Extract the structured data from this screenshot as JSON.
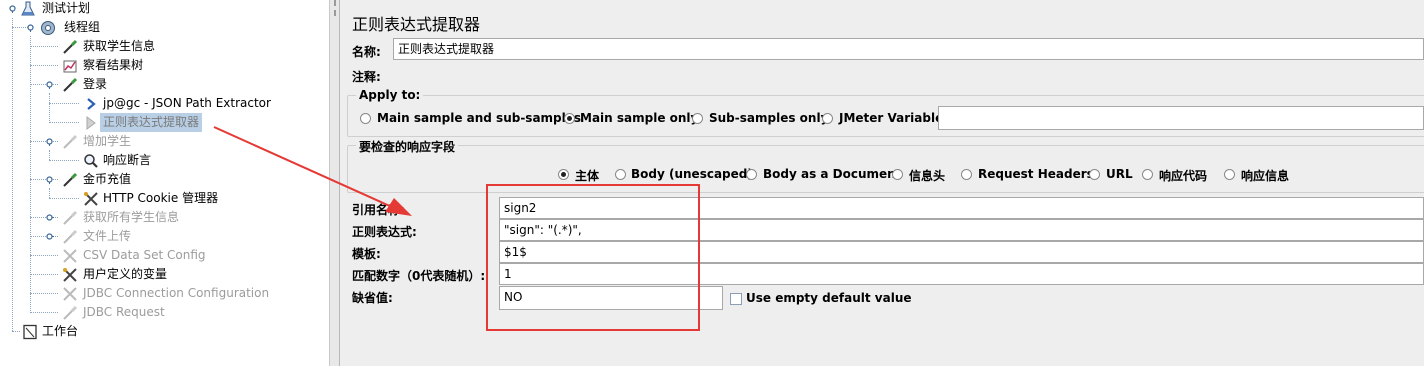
{
  "tree": {
    "test_plan": "测试计划",
    "thread_group": "线程组",
    "get_student_info": "获取学生信息",
    "view_results_tree": "察看结果树",
    "login": "登录",
    "json_extractor": "jp@gc - JSON Path Extractor",
    "regex_extractor": "正则表达式提取器",
    "add_student": "增加学生",
    "response_assertion": "响应断言",
    "coin_recharge": "金币充值",
    "cookie_manager": "HTTP Cookie 管理器",
    "get_all_students": "获取所有学生信息",
    "file_upload": "文件上传",
    "csv_config": "CSV Data Set Config",
    "user_vars": "用户定义的变量",
    "jdbc_config": "JDBC Connection Configuration",
    "jdbc_request": "JDBC Request",
    "workbench": "工作台"
  },
  "panel": {
    "title": "正则表达式提取器",
    "name_label": "名称:",
    "name_value": "正则表达式提取器",
    "comment_label": "注释:",
    "comment_value": "",
    "apply_to": {
      "title": "Apply to:",
      "options": [
        "Main sample and sub-samples",
        "Main sample only",
        "Sub-samples only",
        "JMeter Variable"
      ],
      "selected": "Main sample only",
      "variable_value": ""
    },
    "field_to_check": {
      "title": "要检查的响应字段",
      "options": [
        "主体",
        "Body (unescaped)",
        "Body as a Document",
        "信息头",
        "Request Headers",
        "URL",
        "响应代码",
        "响应信息"
      ],
      "selected": "主体"
    },
    "ref_name_label": "引用名称:",
    "ref_name_value": "sign2",
    "regex_label": "正则表达式:",
    "regex_value": "\"sign\": \"(.*)\",",
    "template_label": "模板:",
    "template_value": "$1$",
    "match_no_label": "匹配数字（0代表随机）:",
    "match_no_value": "1",
    "default_label": "缺省值:",
    "default_value": "NO",
    "use_empty_label": "Use empty default value",
    "use_empty_checked": false
  },
  "colors": {
    "highlight": "#e53935",
    "selection": "#b8cfe5"
  }
}
